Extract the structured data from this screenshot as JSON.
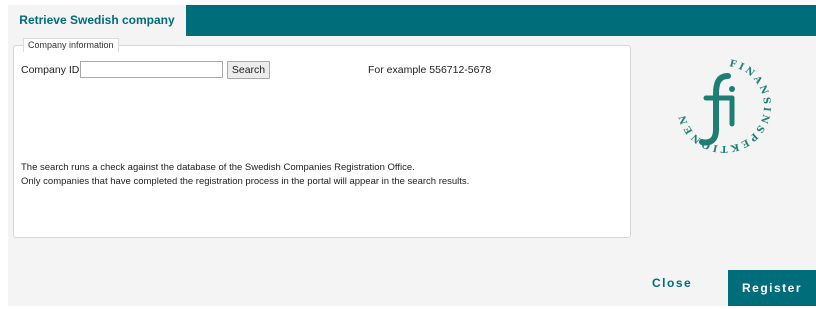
{
  "tabs": {
    "active_label": "Retrieve Swedish company"
  },
  "form": {
    "legend": "Company information",
    "company_id_label": "Company ID",
    "company_id_value": "",
    "search_button": "Search",
    "example_text": "For example 556712-5678",
    "info_line_1": "The search runs a check against the database of the Swedish Companies Registration Office.",
    "info_line_2": "Only companies that have completed the registration process in the portal will appear in the search results."
  },
  "logo": {
    "text": "FINANSINSPEKTIONEN",
    "mark": "fi",
    "color": "#1d7f74"
  },
  "footer": {
    "close_label": "Close",
    "register_label": "Register"
  },
  "colors": {
    "accent": "#006d7b",
    "logo": "#1d7f74"
  }
}
